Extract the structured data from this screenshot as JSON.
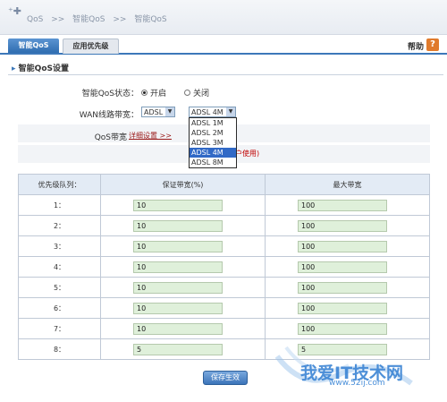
{
  "breadcrumb": [
    "QoS",
    ">>",
    "智能QoS",
    ">>",
    "智能QoS"
  ],
  "tabs": [
    {
      "label": "智能QoS",
      "active": true
    },
    {
      "label": "应用优先级",
      "active": false
    }
  ],
  "help": {
    "label": "帮助",
    "icon": "?"
  },
  "section": {
    "title": "智能QoS设置",
    "marker": "▸"
  },
  "form": {
    "status_label": "智能QoS状态：",
    "status_options": [
      {
        "label": "开启",
        "checked": true
      },
      {
        "label": "关闭",
        "checked": false
      }
    ],
    "wan_label": "WAN线路带宽：",
    "line_type": "ADSL",
    "bandwidth_selected": "ADSL 4M",
    "bandwidth_options": [
      "ADSL 1M",
      "ADSL 2M",
      "ADSL 3M",
      "ADSL 4M",
      "ADSL 8M"
    ],
    "qos_label": "QoS带宽",
    "detail_link": "详细设置 >>",
    "note_partial": "户使用)"
  },
  "table": {
    "headers": [
      "优先级队列：",
      "保证带宽(%)",
      "最大带宽"
    ],
    "rows": [
      {
        "queue": "1：",
        "guaranteed": "10",
        "max": "100"
      },
      {
        "queue": "2：",
        "guaranteed": "10",
        "max": "100"
      },
      {
        "queue": "3：",
        "guaranteed": "10",
        "max": "100"
      },
      {
        "queue": "4：",
        "guaranteed": "10",
        "max": "100"
      },
      {
        "queue": "5：",
        "guaranteed": "10",
        "max": "100"
      },
      {
        "queue": "6：",
        "guaranteed": "10",
        "max": "100"
      },
      {
        "queue": "7：",
        "guaranteed": "10",
        "max": "100"
      },
      {
        "queue": "8：",
        "guaranteed": "5",
        "max": "5"
      }
    ]
  },
  "save_button": "保存生效",
  "watermark": {
    "text": "我爱IT技术网",
    "url": "www.52ij.com"
  },
  "colors": {
    "accent": "#3d78b9",
    "input_bg": "#dff0da",
    "header_bg": "#e3ebf5",
    "note_red": "#c00000"
  }
}
